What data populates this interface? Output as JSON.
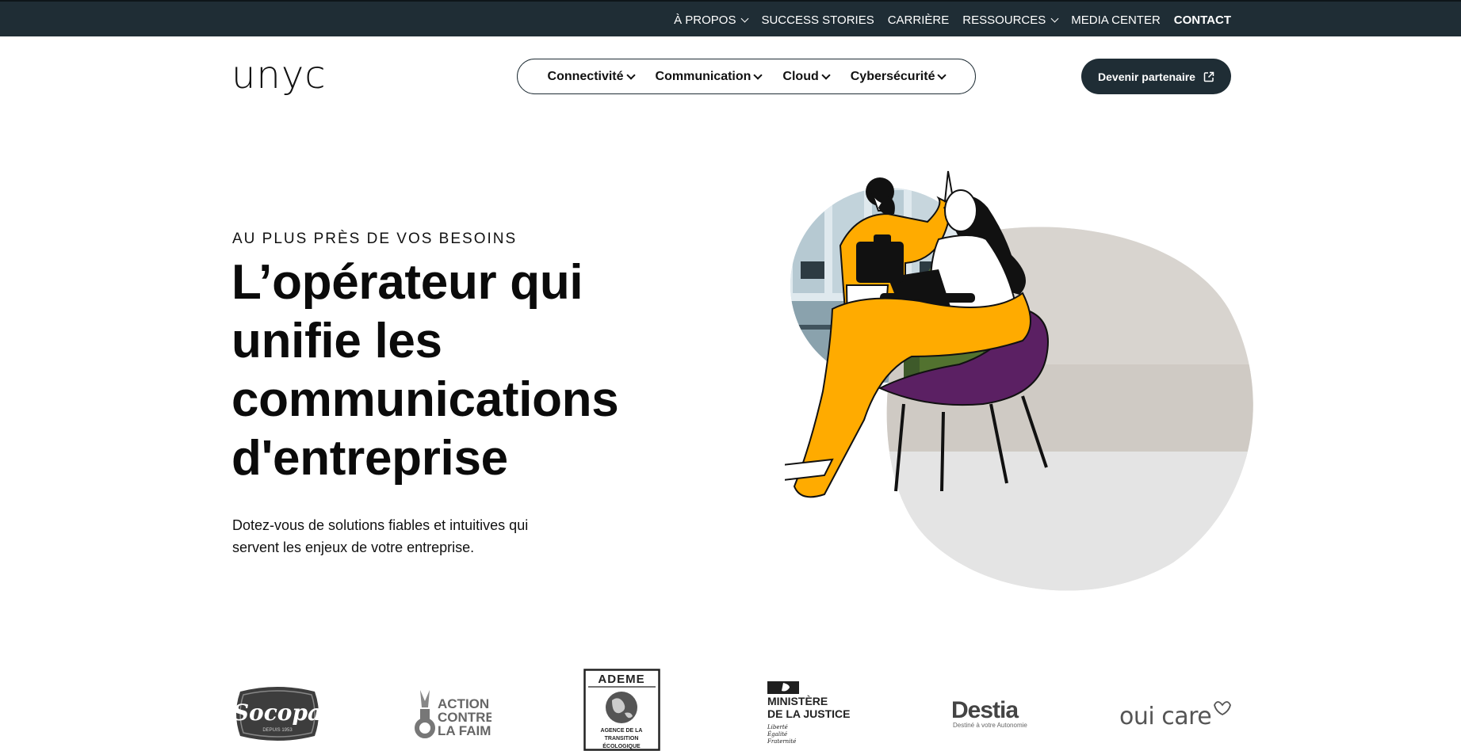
{
  "topnav": {
    "items": [
      {
        "label": "À PROPOS",
        "dropdown": true
      },
      {
        "label": "SUCCESS STORIES",
        "dropdown": false
      },
      {
        "label": "CARRIÈRE",
        "dropdown": false
      },
      {
        "label": "RESSOURCES",
        "dropdown": true
      },
      {
        "label": "MEDIA CENTER",
        "dropdown": false
      },
      {
        "label": "CONTACT",
        "dropdown": false
      }
    ]
  },
  "brand": {
    "name": "unyc"
  },
  "mainnav": {
    "items": [
      {
        "label": "Connectivité"
      },
      {
        "label": "Communication"
      },
      {
        "label": "Cloud"
      },
      {
        "label": "Cybersécurité"
      }
    ]
  },
  "cta": {
    "label": "Devenir partenaire",
    "icon": "external-link-icon"
  },
  "hero": {
    "kicker": "AU PLUS PRÈS DE VOS BESOINS",
    "headline": "L’opérateur qui unifie les communications d'entreprise",
    "subtext": "Dotez-vous de solutions fiables et intuitives qui servent les enjeux de votre entreprise."
  },
  "client_logos": {
    "socopa": {
      "name": "Socopa",
      "tagline": "DEPUIS 1953"
    },
    "acf": {
      "line1": "ACTION",
      "line2": "CONTRE",
      "line3": "LA FAIM"
    },
    "ademe": {
      "name": "ADEME",
      "line1": "AGENCE DE LA",
      "line2": "TRANSITION",
      "line3": "ÉCOLOGIQUE"
    },
    "justice": {
      "line1": "MINISTÈRE",
      "line2": "DE LA JUSTICE",
      "motto1": "Liberté",
      "motto2": "Égalité",
      "motto3": "Fraternité"
    },
    "destia": {
      "name": "Destia",
      "tagline": "Destiné à votre Autonomie"
    },
    "ouicare": {
      "name": "oui care"
    }
  },
  "colors": {
    "dark": "#1f2d35",
    "accent": "#ffab00",
    "purple": "#5b2063"
  }
}
